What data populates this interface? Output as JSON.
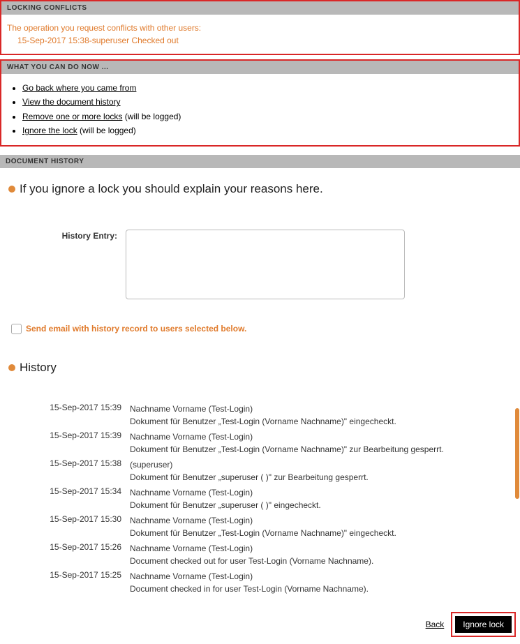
{
  "sections": {
    "locking_conflicts": "LOCKING CONFLICTS",
    "what_you_can_do": "WHAT YOU CAN DO NOW ...",
    "document_history": "DOCUMENT HISTORY"
  },
  "conflict": {
    "message": "The operation you request conflicts with other users:",
    "detail": "15-Sep-2017 15:38-superuser  Checked out"
  },
  "actions": {
    "go_back": "Go back where you came from",
    "view_history": "View the document history",
    "remove_locks": "Remove one or more locks",
    "remove_locks_note": " (will be logged)",
    "ignore_lock": "Ignore the lock",
    "ignore_lock_note": " (will be logged)"
  },
  "explain": {
    "title": "If you ignore a lock you should explain your reasons here.",
    "label": "History Entry:"
  },
  "email": {
    "label": "Send email with history record to users selected below.",
    "checked": false
  },
  "history_heading": "History",
  "history": [
    {
      "ts": "15-Sep-2017 15:39",
      "user": "Nachname Vorname (Test-Login)",
      "msg": "Dokument für Benutzer „Test-Login (Vorname Nachname)\" eingecheckt."
    },
    {
      "ts": "15-Sep-2017 15:39",
      "user": "Nachname Vorname (Test-Login)",
      "msg": "Dokument für Benutzer „Test-Login (Vorname Nachname)\" zur Bearbeitung gesperrt."
    },
    {
      "ts": "15-Sep-2017 15:38",
      "user": "(superuser)",
      "msg": "Dokument für Benutzer „superuser ( )\" zur Bearbeitung gesperrt."
    },
    {
      "ts": "15-Sep-2017 15:34",
      "user": "Nachname Vorname (Test-Login)",
      "msg": "Dokument für Benutzer „superuser ( )\" eingecheckt."
    },
    {
      "ts": "15-Sep-2017 15:30",
      "user": "Nachname Vorname (Test-Login)",
      "msg": "Dokument für Benutzer „Test-Login (Vorname Nachname)\" eingecheckt."
    },
    {
      "ts": "15-Sep-2017 15:26",
      "user": "Nachname Vorname (Test-Login)",
      "msg": "Document checked out for user Test-Login (Vorname Nachname)."
    },
    {
      "ts": "15-Sep-2017 15:25",
      "user": "Nachname Vorname (Test-Login)",
      "msg": "Document checked in for user Test-Login (Vorname Nachname)."
    }
  ],
  "buttons": {
    "back": "Back",
    "ignore": "Ignore lock"
  }
}
